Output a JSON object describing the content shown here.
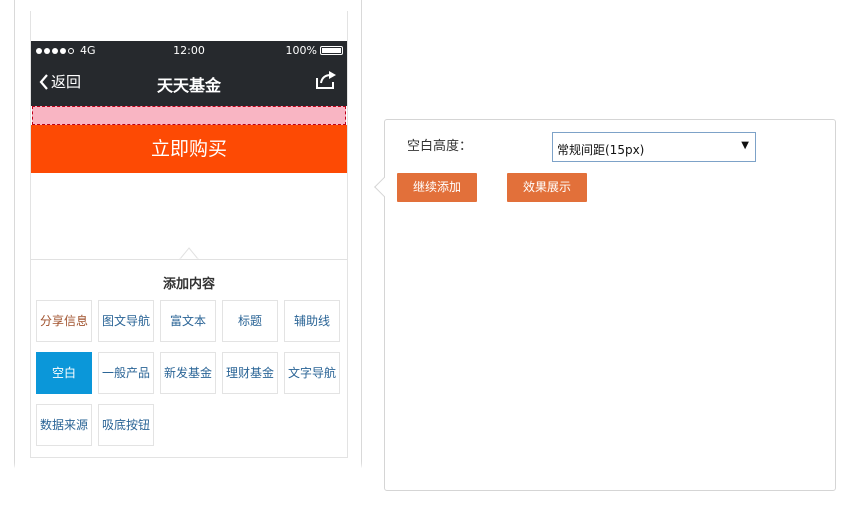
{
  "statusbar": {
    "carrier": "4G",
    "time": "12:00",
    "battery": "100%",
    "battery_level": 1.0
  },
  "navbar": {
    "back_label": "返回",
    "title": "天天基金",
    "back_icon": "chevron-left-icon",
    "share_icon": "share-icon"
  },
  "preview": {
    "buy_button_label": "立即购买"
  },
  "panel": {
    "title": "添加内容",
    "items": [
      {
        "label": "分享信息"
      },
      {
        "label": "图文导航"
      },
      {
        "label": "富文本"
      },
      {
        "label": "标题"
      },
      {
        "label": "辅助线"
      },
      {
        "label": "空白",
        "active": true
      },
      {
        "label": "一般产品"
      },
      {
        "label": "新发基金"
      },
      {
        "label": "理财基金"
      },
      {
        "label": "文字导航"
      },
      {
        "label": "数据来源"
      },
      {
        "label": "吸底按钮"
      }
    ]
  },
  "config": {
    "height_label": "空白高度：",
    "height_selected": "常规间距(15px)",
    "continue_label": "继续添加",
    "preview_label": "效果展示"
  },
  "colors": {
    "nav_bg": "#26292d",
    "buy_button": "#fd4a04",
    "active_tile": "#0b97d9",
    "action_button": "#e2703a",
    "blank_block_fill": "#f9b5c3",
    "blank_block_border": "#c00018"
  }
}
